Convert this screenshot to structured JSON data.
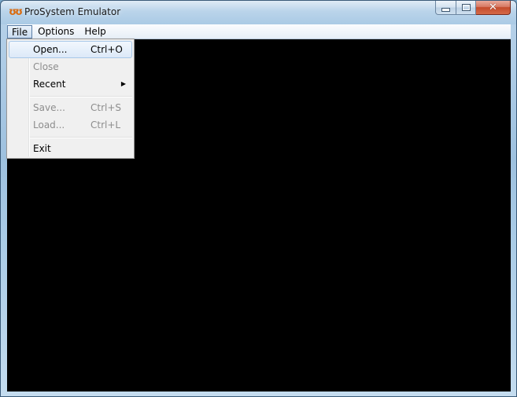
{
  "window": {
    "title": "ProSystem Emulator",
    "app_icon_glyph": "ʊʊ",
    "minimize_glyph": "",
    "close_glyph": "✕"
  },
  "menubar": {
    "items": [
      {
        "label": "File"
      },
      {
        "label": "Options"
      },
      {
        "label": "Help"
      }
    ]
  },
  "file_menu": {
    "open": {
      "label": "Open...",
      "shortcut": "Ctrl+O"
    },
    "close": {
      "label": "Close"
    },
    "recent": {
      "label": "Recent",
      "arrow": "▶"
    },
    "save": {
      "label": "Save...",
      "shortcut": "Ctrl+S"
    },
    "load": {
      "label": "Load...",
      "shortcut": "Ctrl+L"
    },
    "exit": {
      "label": "Exit"
    }
  },
  "colors": {
    "client_background": "#000000",
    "menu_background": "#f0f0f0",
    "disabled_text": "#8d8d8d",
    "app_icon": "#d96b10",
    "close_button": "#c44b2c"
  },
  "icons": {
    "app": "atari-fuji-icon",
    "submenu": "chevron-right-icon"
  }
}
